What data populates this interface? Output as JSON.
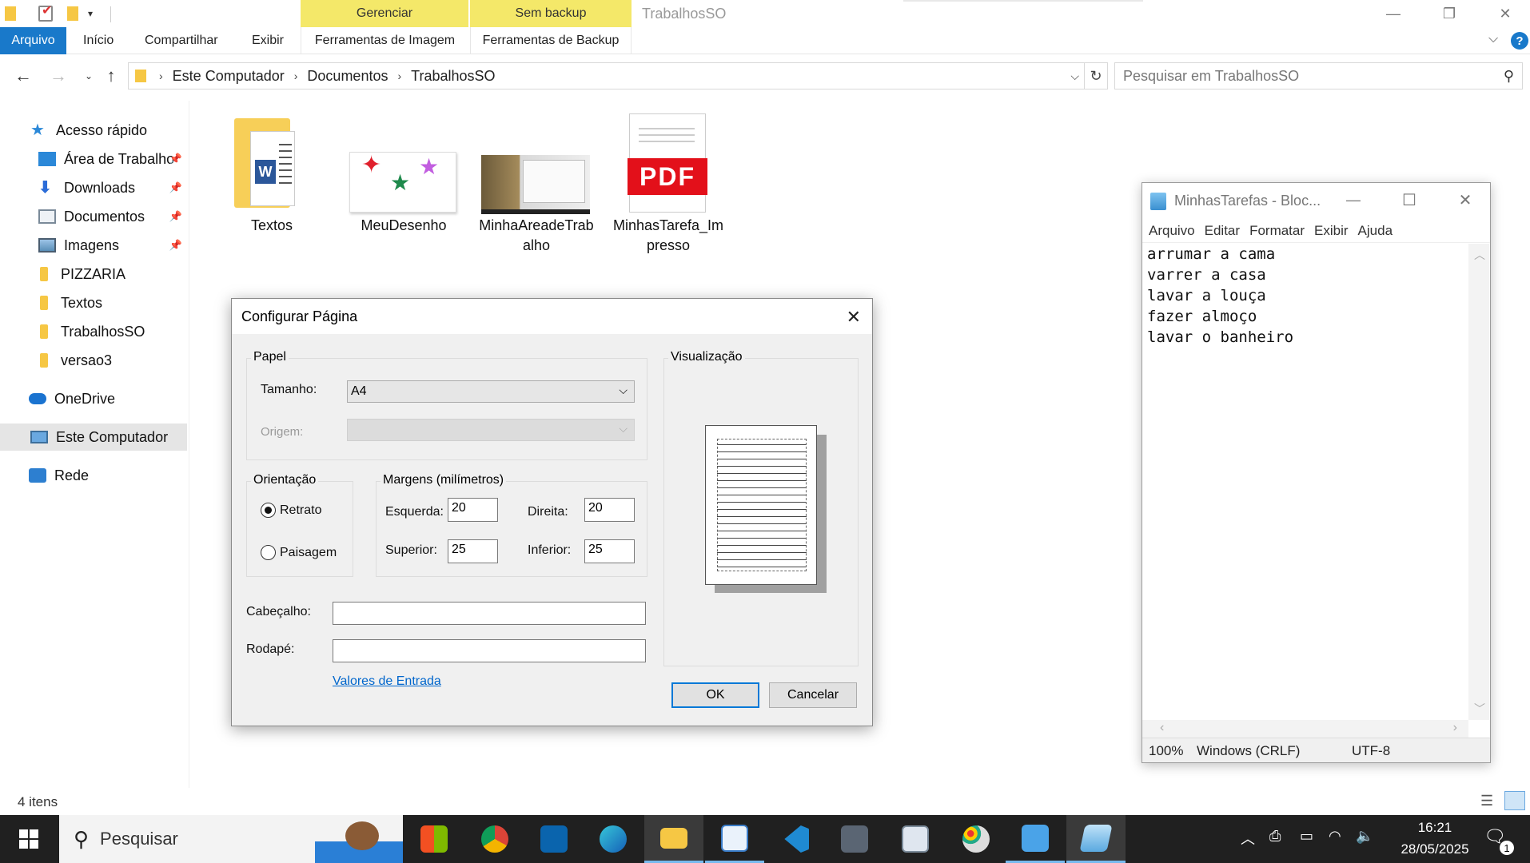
{
  "ribbon": {
    "context_tabs": [
      {
        "header": "Gerenciar",
        "tab": "Ferramentas de Imagem"
      },
      {
        "header": "Sem backup",
        "tab": "Ferramentas de Backup"
      }
    ],
    "window_title": "TrabalhosSO",
    "tabs": [
      "Arquivo",
      "Início",
      "Compartilhar",
      "Exibir"
    ]
  },
  "address": {
    "crumbs": [
      "Este Computador",
      "Documentos",
      "TrabalhosSO"
    ],
    "search_placeholder": "Pesquisar em TrabalhosSO"
  },
  "nav": {
    "items": [
      {
        "label": "Acesso rápido",
        "icon": "star-icon"
      },
      {
        "label": "Área de Trabalho",
        "icon": "desktop-icon",
        "pinned": true
      },
      {
        "label": "Downloads",
        "icon": "download-icon",
        "pinned": true
      },
      {
        "label": "Documentos",
        "icon": "documents-icon",
        "pinned": true
      },
      {
        "label": "Imagens",
        "icon": "pictures-icon",
        "pinned": true
      },
      {
        "label": "PIZZARIA",
        "icon": "folder-icon"
      },
      {
        "label": "Textos",
        "icon": "folder-icon"
      },
      {
        "label": "TrabalhosSO",
        "icon": "folder-icon"
      },
      {
        "label": "versao3",
        "icon": "folder-icon"
      },
      {
        "label": "OneDrive",
        "icon": "cloud-icon"
      },
      {
        "label": "Este Computador",
        "icon": "computer-icon",
        "selected": true
      },
      {
        "label": "Rede",
        "icon": "network-icon"
      }
    ]
  },
  "files": [
    {
      "label": "Textos",
      "icon": "word-folder-icon"
    },
    {
      "label": "MeuDesenho",
      "icon": "drawing-thumbnail-icon"
    },
    {
      "label": "MinhaAreadeTrab alho",
      "icon": "screenshot-thumbnail-icon"
    },
    {
      "label": "MinhasTarefa_Im presso",
      "icon": "pdf-icon",
      "badge": "PDF"
    }
  ],
  "dialog": {
    "title": "Configurar Página",
    "paper": {
      "group": "Papel",
      "size_label": "Tamanho:",
      "size_value": "A4",
      "source_label": "Origem:"
    },
    "orientation": {
      "group": "Orientação",
      "portrait": "Retrato",
      "landscape": "Paisagem",
      "selected": "Retrato"
    },
    "margins": {
      "group": "Margens (milímetros)",
      "left_label": "Esquerda:",
      "left": "20",
      "right_label": "Direita:",
      "right": "20",
      "top_label": "Superior:",
      "top": "25",
      "bottom_label": "Inferior:",
      "bottom": "25"
    },
    "header_label": "Cabeçalho:",
    "footer_label": "Rodapé:",
    "defaults_link": "Valores de Entrada",
    "preview_label": "Visualização",
    "ok": "OK",
    "cancel": "Cancelar"
  },
  "notepad": {
    "title": "MinhasTarefas - Bloc...",
    "menu": [
      "Arquivo",
      "Editar",
      "Formatar",
      "Exibir",
      "Ajuda"
    ],
    "lines": [
      "arrumar a cama",
      "varrer a casa",
      "lavar a louça",
      "fazer almoço",
      "lavar o banheiro"
    ],
    "status": {
      "zoom": "100%",
      "eol": "Windows (CRLF)",
      "encoding": "UTF-8"
    }
  },
  "statusbar": {
    "count": "4 itens"
  },
  "taskbar": {
    "search_placeholder": "Pesquisar",
    "apps": [
      "windows-store-icon",
      "chrome-icon",
      "outlook-icon",
      "edge-icon",
      "file-explorer-icon",
      "wordpad-icon",
      "vscode-icon",
      "calculator-icon",
      "task-manager-icon",
      "paint-icon",
      "control-panel-icon",
      "notepad-icon"
    ],
    "time": "16:21",
    "date": "28/05/2025",
    "notifications": "1"
  },
  "colors": {
    "accent": "#1979ca",
    "context_tab": "#f4e869",
    "taskbar": "#202020"
  }
}
